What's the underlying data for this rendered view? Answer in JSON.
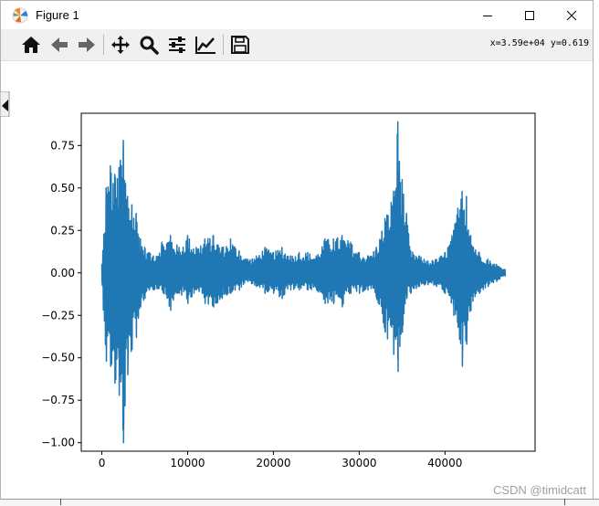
{
  "window": {
    "title": "Figure 1"
  },
  "toolbar": {
    "buttons": [
      {
        "icon": "home-icon"
      },
      {
        "icon": "back-arrow-icon"
      },
      {
        "icon": "forward-arrow-icon"
      },
      {
        "icon": "pan-icon"
      },
      {
        "icon": "zoom-icon"
      },
      {
        "icon": "subplots-config-icon"
      },
      {
        "icon": "edit-axis-icon"
      },
      {
        "icon": "save-icon"
      }
    ],
    "coordinates": "x=3.59e+04 y=0.619"
  },
  "watermark": "CSDN @timidcatt",
  "chart_data": {
    "type": "line",
    "title": "",
    "xlabel": "",
    "ylabel": "",
    "xlim": [
      -2400,
      50500
    ],
    "ylim": [
      -1.05,
      0.94
    ],
    "xticks": [
      0,
      10000,
      20000,
      30000,
      40000
    ],
    "xtick_labels": [
      "0",
      "10000",
      "20000",
      "30000",
      "40000"
    ],
    "yticks": [
      -1.0,
      -0.75,
      -0.5,
      -0.25,
      0.0,
      0.25,
      0.5,
      0.75
    ],
    "ytick_labels": [
      "−1.00",
      "−0.75",
      "−0.50",
      "−0.25",
      "0.00",
      "0.25",
      "0.50",
      "0.75"
    ],
    "color": "#1f77b4",
    "grid": false,
    "series": [
      {
        "x": [
          0,
          500,
          1000,
          1500,
          2000,
          2500,
          3000,
          3500,
          4000,
          4500,
          5000,
          5500,
          6000,
          7000,
          8000,
          9000,
          10000,
          11000,
          12000,
          13000,
          14000,
          15000,
          16000,
          17000,
          18000,
          19000,
          20000,
          21000,
          22000,
          23000,
          24000,
          25000,
          26000,
          27000,
          28000,
          29000,
          30000,
          31000,
          32000,
          33000,
          34000,
          34500,
          35000,
          35500,
          36000,
          37000,
          38000,
          39000,
          40000,
          41000,
          41500,
          42000,
          42500,
          43000,
          44000,
          45000,
          46000,
          47000
        ],
        "upper": [
          0.05,
          0.5,
          0.63,
          0.58,
          0.62,
          0.78,
          0.45,
          0.4,
          0.35,
          0.2,
          0.15,
          0.12,
          0.1,
          0.18,
          0.22,
          0.15,
          0.22,
          0.15,
          0.2,
          0.22,
          0.15,
          0.2,
          0.13,
          0.08,
          0.1,
          0.15,
          0.12,
          0.15,
          0.1,
          0.12,
          0.12,
          0.1,
          0.2,
          0.2,
          0.22,
          0.18,
          0.12,
          0.1,
          0.15,
          0.32,
          0.48,
          0.89,
          0.55,
          0.35,
          0.13,
          0.1,
          0.07,
          0.08,
          0.12,
          0.25,
          0.38,
          0.48,
          0.45,
          0.22,
          0.12,
          0.08,
          0.05,
          0.02
        ],
        "lower": [
          -0.05,
          -0.52,
          -0.55,
          -0.65,
          -0.72,
          -1.0,
          -0.6,
          -0.45,
          -0.38,
          -0.2,
          -0.15,
          -0.1,
          -0.1,
          -0.1,
          -0.22,
          -0.12,
          -0.18,
          -0.1,
          -0.18,
          -0.2,
          -0.15,
          -0.12,
          -0.1,
          -0.05,
          -0.08,
          -0.12,
          -0.12,
          -0.15,
          -0.1,
          -0.1,
          -0.1,
          -0.1,
          -0.18,
          -0.18,
          -0.2,
          -0.12,
          -0.12,
          -0.1,
          -0.15,
          -0.35,
          -0.48,
          -0.58,
          -0.35,
          -0.15,
          -0.12,
          -0.08,
          -0.07,
          -0.08,
          -0.12,
          -0.25,
          -0.32,
          -0.55,
          -0.42,
          -0.22,
          -0.12,
          -0.08,
          -0.05,
          -0.02
        ]
      }
    ]
  }
}
